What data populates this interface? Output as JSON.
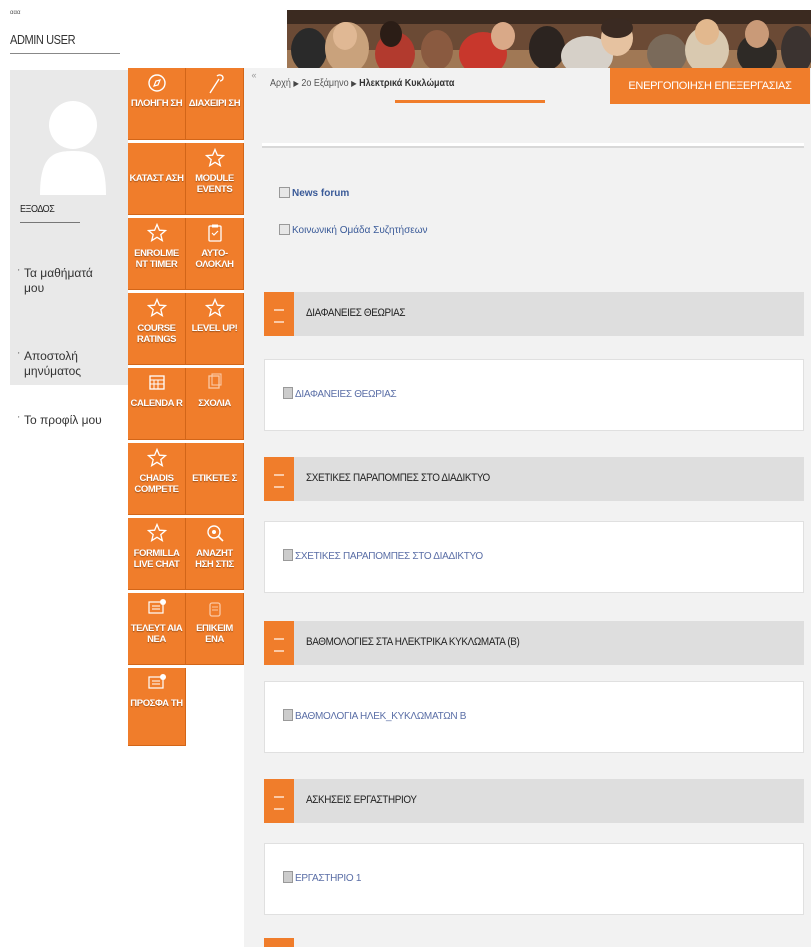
{
  "user": {
    "small_label": "ααα",
    "name": "ADMIN USER",
    "logout": "ΕΞΟΔΟΣ",
    "links": [
      "Τα μαθήματά μου",
      "Αποστολή μηνύματος",
      "Το προφίλ μου"
    ]
  },
  "menu": [
    {
      "label": "ΠΛΟΗΓΗ ΣΗ",
      "icon": "compass-icon"
    },
    {
      "label": "ΔΙΑΧΕΙΡΙ ΣΗ",
      "icon": "wrench-icon"
    },
    {
      "label": "ΚΑΤΑΣΤ ΑΣΗ",
      "icon": "blank-icon"
    },
    {
      "label": "MODULE EVENTS",
      "icon": "star-icon"
    },
    {
      "label": "ENROLME NT TIMER",
      "icon": "star-icon"
    },
    {
      "label": "ΑΥΤΟ-ΟΛΟΚΛΗ",
      "icon": "clipboard-icon"
    },
    {
      "label": "COURSE RATINGS",
      "icon": "star-icon"
    },
    {
      "label": "LEVEL UP!",
      "icon": "star-icon"
    },
    {
      "label": "CALENDA R",
      "icon": "calendar-icon"
    },
    {
      "label": "ΣΧΟΛΙΑ",
      "icon": "comments-icon"
    },
    {
      "label": "CHADIS COMPETE",
      "icon": "star-icon"
    },
    {
      "label": "ΕΤΙΚΕΤΕ Σ",
      "icon": "blank-icon"
    },
    {
      "label": "FORMILLA LIVE CHAT",
      "icon": "star-icon"
    },
    {
      "label": "ΑΝΑΖΗΤ ΗΣΗ ΣΤΙΣ",
      "icon": "search-icon"
    },
    {
      "label": "ΤΕΛΕΥΤ ΑΙΑ ΝΕΑ",
      "icon": "news-icon"
    },
    {
      "label": "ΕΠΙΚΕΙΜ ΕΝΑ",
      "icon": "pot-icon"
    },
    {
      "label": "ΠΡΟΣΦΑ ΤΗ",
      "icon": "news-icon"
    }
  ],
  "breadcrumb": [
    "Αρχή",
    "2o Εξάμηνο",
    "Ηλεκτρικά Κυκλώματα"
  ],
  "edit_button": "ΕΝΕΡΓΟΠΟΙΗΣΗ ΕΠΕΞΕΡΓΑΣΙΑΣ",
  "forums": [
    "News forum",
    "Κοινωνική Ομάδα Συζητήσεων"
  ],
  "sections": [
    {
      "title": "ΔΙΑΦΑΝΕΙΕΣ ΘΕΩΡΙΑΣ",
      "resource": "ΔΙΑΦΑΝΕΙΕΣ ΘΕΩΡΙΑΣ"
    },
    {
      "title": "ΣΧΕΤΙΚΕΣ ΠΑΡΑΠΟΜΠΕΣ ΣΤΟ ΔΙΑΔΙΚΤΥΟ",
      "resource": "ΣΧΕΤΙΚΕΣ ΠΑΡΑΠΟΜΠΕΣ ΣΤΟ ΔΙΑΔΙΚΤΥΟ"
    },
    {
      "title": "ΒΑΘΜΟΛΟΓΙΕΣ ΣΤΑ ΗΛΕΚΤΡΙΚΑ ΚΥΚΛΩΜΑΤΑ (Β)",
      "resource": "ΒΑΘΜΟΛΟΓΙΑ ΗΛΕΚ_ΚΥΚΛΩΜΑΤΩΝ Β"
    },
    {
      "title": "ΑΣΚΗΣΕΙΣ ΕΡΓΑΣΤΗΡΙΟΥ",
      "resource": "ΕΡΓΑΣΤΗΡΙΟ 1"
    }
  ],
  "colors": {
    "accent": "#f07d2b",
    "section_bg": "#dedede",
    "link": "#3a5a98"
  }
}
